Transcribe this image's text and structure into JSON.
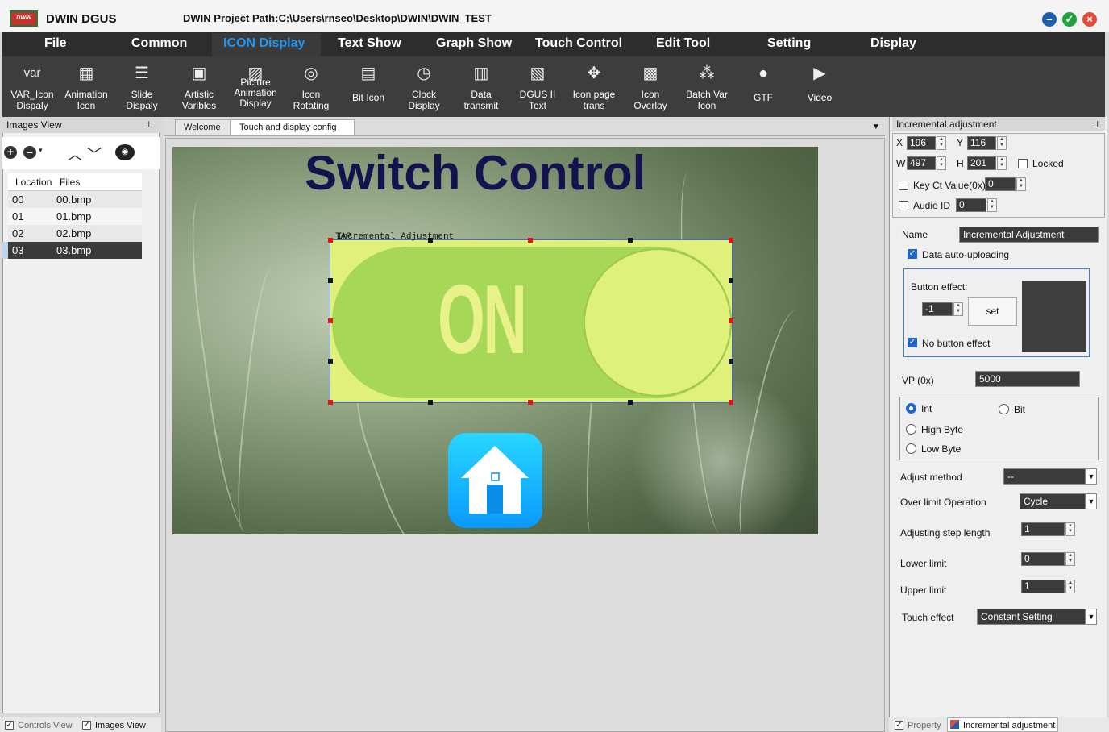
{
  "app": {
    "logo_text": "DWIN",
    "name": "DWIN DGUS",
    "project_path": "DWIN Project Path:C:\\Users\\rnseo\\Desktop\\DWIN\\DWIN_TEST"
  },
  "window_buttons": {
    "minimize": "–",
    "maximize": "✓",
    "close": "×"
  },
  "menu": [
    "File",
    "Common",
    "ICON Display",
    "Text Show",
    "Graph Show",
    "Touch Control",
    "Edit Tool",
    "Setting",
    "Display"
  ],
  "toolbar": [
    {
      "label": "VAR_Icon\nDispaly",
      "icon": "var-text-icon",
      "glyph": "var"
    },
    {
      "label": "Animation\nIcon",
      "icon": "film-icon",
      "glyph": "▦"
    },
    {
      "label": "Slide\nDispaly",
      "icon": "slider-icon",
      "glyph": "☰"
    },
    {
      "label": "Artistic\nVaribles",
      "icon": "artistic-icon",
      "glyph": "▣"
    },
    {
      "label": "Picture\nAnimation\nDisplay",
      "icon": "picture-icon",
      "glyph": "▨"
    },
    {
      "label": "Icon\nRotating",
      "icon": "rotate-icon",
      "glyph": "◎"
    },
    {
      "label": "Bit Icon",
      "icon": "bit-icon",
      "glyph": "▤"
    },
    {
      "label": "Clock\nDisplay",
      "icon": "clock-icon",
      "glyph": "◷"
    },
    {
      "label": "Data\ntransmit",
      "icon": "data-icon",
      "glyph": "▥"
    },
    {
      "label": "DGUS II\nText",
      "icon": "text-icon",
      "glyph": "▧"
    },
    {
      "label": "Icon page\ntrans",
      "icon": "move-icon",
      "glyph": "✥"
    },
    {
      "label": "Icon\nOverlay",
      "icon": "overlay-icon",
      "glyph": "▩"
    },
    {
      "label": "Batch Var\nIcon",
      "icon": "batch-icon",
      "glyph": "⁂"
    },
    {
      "label": "GTF",
      "icon": "gtf-icon",
      "glyph": "●"
    },
    {
      "label": "Video",
      "icon": "video-icon",
      "glyph": "▶"
    }
  ],
  "images_view": {
    "title": "Images View",
    "pin": "⊥",
    "columns": [
      "Location",
      "Files"
    ],
    "rows": [
      {
        "loc": "00",
        "file": "00.bmp"
      },
      {
        "loc": "01",
        "file": "01.bmp"
      },
      {
        "loc": "02",
        "file": "02.bmp"
      },
      {
        "loc": "03",
        "file": "03.bmp"
      }
    ],
    "bottom_tabs": [
      "Controls View",
      "Images View"
    ]
  },
  "tabs": [
    "Welcome",
    "Touch and display config"
  ],
  "canvas": {
    "title": "Switch Control",
    "switch_text": "ON",
    "selection_label": "Incremental Adjustment",
    "selection_label_overlap": "TAP"
  },
  "right": {
    "title": "Incremental adjustment",
    "pin": "⊥",
    "x_label": "X",
    "x": "196",
    "y_label": "Y",
    "y": "116",
    "w_label": "W",
    "w": "497",
    "h_label": "H",
    "h": "201",
    "locked": "Locked",
    "key_ct": "Key Ct Value(0x)",
    "key_ct_val": "0",
    "audio": "Audio ID",
    "audio_val": "0",
    "name_label": "Name",
    "name_val": "Incremental Adjustment",
    "data_auto": "Data auto-uploading",
    "button_effect": "Button effect:",
    "button_effect_val": "-1",
    "set": "set",
    "no_button_effect": "No button effect",
    "vp_label": "VP (0x)",
    "vp_val": "5000",
    "int": "Int",
    "bit": "Bit",
    "high_byte": "High Byte",
    "low_byte": "Low Byte",
    "adjust_method": "Adjust method",
    "adjust_method_val": "--",
    "over_limit": "Over limit Operation",
    "over_limit_val": "Cycle",
    "step_length": "Adjusting step length",
    "step_val": "1",
    "lower_limit": "Lower limit",
    "lower_val": "0",
    "upper_limit": "Upper limit",
    "upper_val": "1",
    "touch_effect": "Touch effect",
    "touch_effect_val": "Constant Setting",
    "bottom_tabs": [
      "Property",
      "Incremental adjustment"
    ]
  },
  "colors": {
    "accent": "#1e90ff",
    "menu_bg": "#2d2d2d",
    "toolbar_bg": "#3d3d3d",
    "check": "#1f66c7"
  }
}
